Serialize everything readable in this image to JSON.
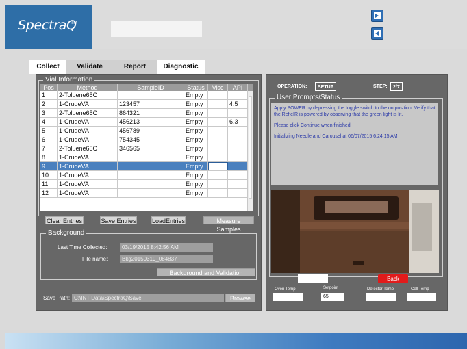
{
  "app": {
    "logo_text": "SpectraQ",
    "logo_tm": "TM"
  },
  "header": {
    "field_value": "",
    "icons": [
      "export-icon",
      "import-icon"
    ]
  },
  "tabs": [
    {
      "label": "Collect",
      "active": true
    },
    {
      "label": "Validate",
      "active": false
    },
    {
      "label": "Report",
      "active": false
    },
    {
      "label": "Diagnostic",
      "active": true
    }
  ],
  "vial_information": {
    "title": "Vial Information",
    "columns": [
      "Pos",
      "Method",
      "SampleID",
      "Status",
      "Visc",
      "API"
    ],
    "rows": [
      {
        "pos": "1",
        "method": "2-Toluene65C",
        "sample_id": "",
        "status": "Empty",
        "visc": "",
        "api": ""
      },
      {
        "pos": "2",
        "method": "1-CrudeVA",
        "sample_id": "123457",
        "status": "Empty",
        "visc": "",
        "api": "4.5"
      },
      {
        "pos": "3",
        "method": "2-Toluene65C",
        "sample_id": "864321",
        "status": "Empty",
        "visc": "",
        "api": ""
      },
      {
        "pos": "4",
        "method": "1-CrudeVA",
        "sample_id": "456213",
        "status": "Empty",
        "visc": "",
        "api": "6.3"
      },
      {
        "pos": "5",
        "method": "1-CrudeVA",
        "sample_id": "456789",
        "status": "Empty",
        "visc": "",
        "api": ""
      },
      {
        "pos": "6",
        "method": "1-CrudeVA",
        "sample_id": "754345",
        "status": "Empty",
        "visc": "",
        "api": ""
      },
      {
        "pos": "7",
        "method": "2-Toluene65C",
        "sample_id": "346565",
        "status": "Empty",
        "visc": "",
        "api": ""
      },
      {
        "pos": "8",
        "method": "1-CrudeVA",
        "sample_id": "",
        "status": "Empty",
        "visc": "",
        "api": ""
      },
      {
        "pos": "9",
        "method": "1-CrudeVA",
        "sample_id": "",
        "status": "Empty",
        "visc": "",
        "api": "",
        "selected": true
      },
      {
        "pos": "10",
        "method": "1-CrudeVA",
        "sample_id": "",
        "status": "Empty",
        "visc": "",
        "api": ""
      },
      {
        "pos": "11",
        "method": "1-CrudeVA",
        "sample_id": "",
        "status": "Empty",
        "visc": "",
        "api": ""
      },
      {
        "pos": "12",
        "method": "1-CrudeVA",
        "sample_id": "",
        "status": "Empty",
        "visc": "",
        "api": ""
      }
    ]
  },
  "buttons": {
    "clear_entries": "Clear Entries",
    "save_entries": "Save Entries",
    "load_entries": "LoadEntries",
    "measure_samples": "Measure Samples",
    "background_validation": "Background and Validation",
    "browse": "Browse",
    "back": "Back"
  },
  "background": {
    "title": "Background",
    "last_time_label": "Last Time Collected:",
    "last_time_value": "03/19/2015 8:42:56 AM",
    "file_name_label": "File name:",
    "file_name_value": "Bkg20150319_084837"
  },
  "save_path": {
    "label": "Save Path:",
    "value": "C:\\INT Data\\SpectraQ\\Save"
  },
  "operation": {
    "label": "OPERATION:",
    "value": "SETUP",
    "step_label": "STEP:",
    "step_value": "2/7"
  },
  "prompts": {
    "title": "User Prompts/Status",
    "line1": "Apply POWER by depressing the toggle switch to the on position. Verify that the RefleIR is powered by observing that the green light is lit.",
    "line2": "Please click Continue when finished.",
    "line3": "Initializing Needle and Carousel at 06/07/2015 6:24:15 AM"
  },
  "temps": {
    "oven_label": "Oven Temp",
    "setpoint_label": "Setpoint",
    "setpoint_value": "65",
    "detector_label": "Detector Temp",
    "cell_label": "Cell Temp"
  },
  "colors": {
    "brand": "#2e6ea7",
    "selection": "#4a80be",
    "back_button": "#e11b1b",
    "panel": "#676767"
  }
}
